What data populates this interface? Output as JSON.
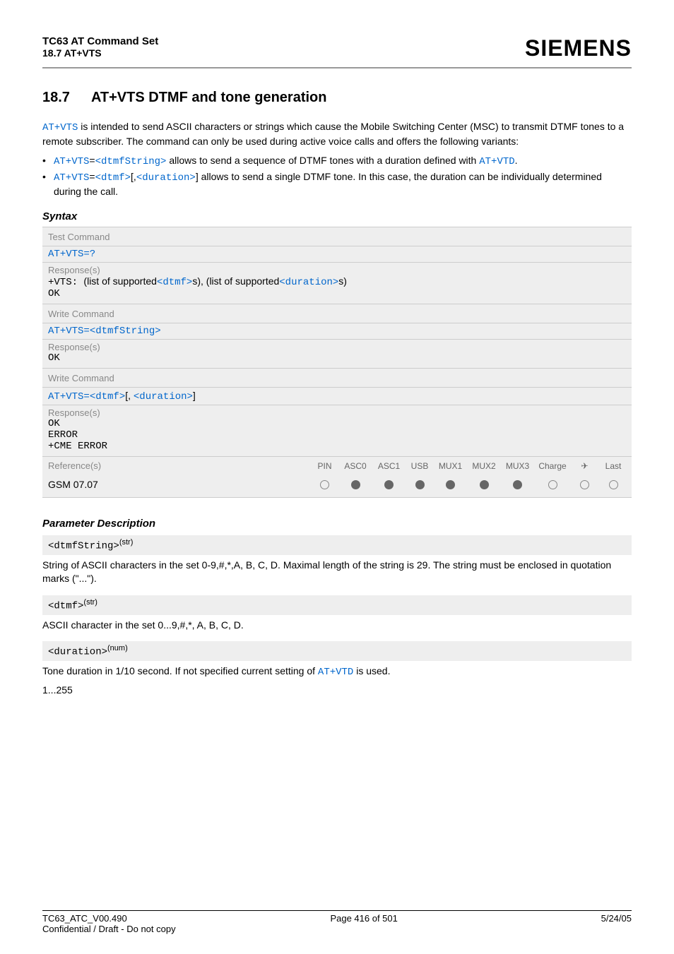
{
  "header": {
    "title": "TC63 AT Command Set",
    "subtitle": "18.7 AT+VTS",
    "brand": "SIEMENS"
  },
  "section": {
    "number": "18.7",
    "title": "AT+VTS   DTMF and tone generation"
  },
  "intro": {
    "cmd": "AT+VTS",
    "text1": " is intended to send ASCII characters or strings which cause the Mobile Switching Center (MSC) to transmit DTMF tones to a remote subscriber. The command can only be used during active voice calls and offers the following variants:"
  },
  "bullets": [
    {
      "pre": "AT+VTS",
      "eq": "=",
      "arg": "<dtmfString>",
      "post1": " allows to send a sequence of DTMF tones with a duration defined with ",
      "trail": "AT+VTD",
      "end": "."
    },
    {
      "pre": "AT+VTS",
      "eq": "=",
      "arg": "<dtmf>",
      "mid": "[,",
      "arg2": "<duration>",
      "post1": "] allows to send a single DTMF tone. In this case, the duration can be individually determined during the call."
    }
  ],
  "syntax": {
    "heading": "Syntax",
    "test_label": "Test Command",
    "test_cmd": "AT+VTS=?",
    "responses_label": "Response(s)",
    "test_resp_prefix": "+VTS:",
    "test_resp_list1": "(list of supported",
    "test_resp_arg1": "<dtmf>",
    "test_resp_list2": "s), (list of supported",
    "test_resp_arg2": "<duration>",
    "test_resp_list3": "s)",
    "ok": "OK",
    "write_label": "Write Command",
    "write1_cmd_pre": "AT+VTS=",
    "write1_arg": "<dtmfString>",
    "write2_cmd_pre": "AT+VTS=",
    "write2_arg1": "<dtmf>",
    "write2_mid": "[, ",
    "write2_arg2": "<duration>",
    "write2_end": "]",
    "error": "ERROR",
    "cme_error": "+CME ERROR"
  },
  "reference": {
    "label": "Reference(s)",
    "cols": [
      "PIN",
      "ASC0",
      "ASC1",
      "USB",
      "MUX1",
      "MUX2",
      "MUX3",
      "Charge",
      "✈",
      "Last"
    ],
    "value": "GSM 07.07",
    "states": [
      "empty",
      "filled",
      "filled",
      "filled",
      "filled",
      "filled",
      "filled",
      "empty",
      "empty",
      "empty"
    ]
  },
  "params": {
    "heading": "Parameter Description",
    "p1_name": "<dtmfString>",
    "p1_sup": "(str)",
    "p1_desc": "String of ASCII characters in the set 0-9,#,*,A, B, C, D. Maximal length of the string is 29. The string must be enclosed in quotation marks (\"...\").",
    "p2_name": "<dtmf>",
    "p2_sup": "(str)",
    "p2_desc": "ASCII character in the set 0...9,#,*, A, B, C, D.",
    "p3_name": "<duration>",
    "p3_sup": "(num)",
    "p3_desc_pre": "Tone duration in 1/10 second. If not specified current setting of ",
    "p3_desc_cmd": "AT+VTD",
    "p3_desc_post": " is used.",
    "p3_range": "1...255"
  },
  "footer": {
    "left": "TC63_ATC_V00.490",
    "center": "Page 416 of 501",
    "right": "5/24/05",
    "sub": "Confidential / Draft - Do not copy"
  }
}
